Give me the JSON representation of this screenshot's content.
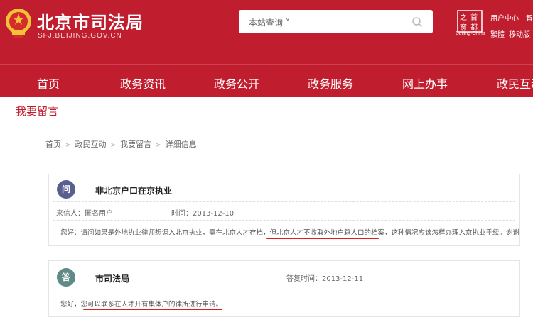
{
  "header": {
    "site_name": "北京市司法局",
    "site_domain": "SFJ.BEIJING.GOV.CN",
    "search_scope": "本站查询",
    "logo_caption": "Beijing·China",
    "logo_chars": [
      "之",
      "首",
      "窗",
      "都"
    ],
    "util_links": [
      "用户中心",
      "智",
      "繁體",
      "移动版"
    ]
  },
  "nav": {
    "items": [
      "首页",
      "政务资讯",
      "政务公开",
      "政务服务",
      "网上办事",
      "政民互动"
    ]
  },
  "section": {
    "title": "我要留言"
  },
  "breadcrumb": {
    "items": [
      "首页",
      "政民互动",
      "我要留言",
      "详细信息"
    ]
  },
  "question": {
    "badge": "问",
    "title": "非北京户口在京执业",
    "sender_label": "来信人：",
    "sender": "匿名用户",
    "time_label": "时间：",
    "time": "2013-12-10",
    "body_before": "您好：请问如果是外地执业律师想调入北京执业，需在北京人才存档，",
    "body_marked": "但北京人才不收取外地户籍人口的档案",
    "body_after": "，这种情况应该怎样办理入京执业手续。谢谢"
  },
  "answer": {
    "badge": "答",
    "title": "市司法局",
    "time_label": "答复时间：",
    "time": "2013-12-11",
    "body_before": "您好，",
    "body_marked": "您可以联系在人才开有集体户的律所进行申请。"
  },
  "colors": {
    "brand_red": "#c01e2f",
    "question_badge": "#5a5f92",
    "answer_badge": "#5f8a85",
    "annotation_red": "#d9201f"
  }
}
